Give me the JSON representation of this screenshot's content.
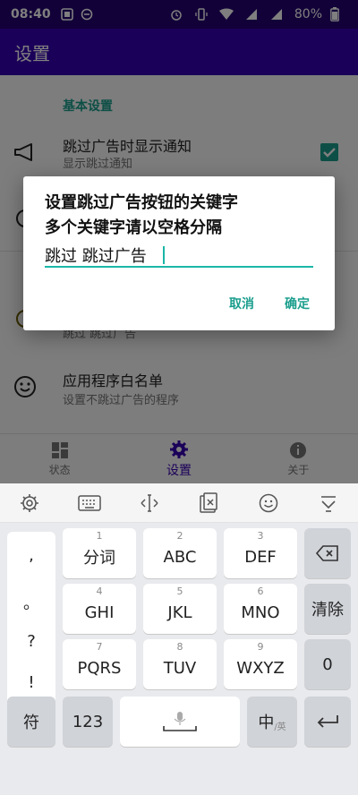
{
  "status_bar": {
    "time": "08:40",
    "battery": "80%"
  },
  "app_bar": {
    "title": "设置"
  },
  "settings": {
    "section": "基本设置",
    "items": [
      {
        "title": "跳过广告时显示通知",
        "summary": "显示跳过通知"
      },
      {
        "title": "",
        "summary": "跳过 跳过广告"
      },
      {
        "title": "应用程序白名单",
        "summary": "设置不跳过广告的程序"
      }
    ]
  },
  "bottom_nav": {
    "items": [
      {
        "label": "状态"
      },
      {
        "label": "设置"
      },
      {
        "label": "关于"
      }
    ]
  },
  "dialog": {
    "title_line1": "设置跳过广告按钮的关键字",
    "title_line2": "多个关键字请以空格分隔",
    "input_value": "跳过 跳过广告",
    "cancel": "取消",
    "confirm": "确定"
  },
  "keyboard": {
    "punctuation": [
      ",",
      "。",
      "?",
      "!"
    ],
    "keys": [
      {
        "num": "1",
        "label": "分词"
      },
      {
        "num": "2",
        "label": "ABC"
      },
      {
        "num": "3",
        "label": "DEF"
      },
      {
        "num": "4",
        "label": "GHI"
      },
      {
        "num": "5",
        "label": "JKL"
      },
      {
        "num": "6",
        "label": "MNO"
      },
      {
        "num": "7",
        "label": "PQRS"
      },
      {
        "num": "8",
        "label": "TUV"
      },
      {
        "num": "9",
        "label": "WXYZ"
      }
    ],
    "clear": "清除",
    "zero": "0",
    "symbol": "符",
    "numeric": "123",
    "lang_main": "中",
    "lang_sub": "/英"
  },
  "colors": {
    "primary": "#3700b3",
    "status": "#240070",
    "accent": "#1b9e8d"
  }
}
